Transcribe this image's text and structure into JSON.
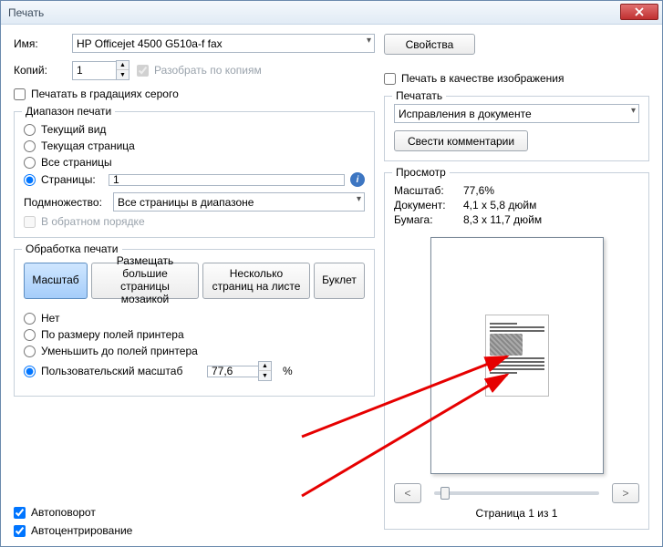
{
  "window": {
    "title": "Печать"
  },
  "top": {
    "name_label": "Имя:",
    "printer": "HP Officejet 4500 G510a-f fax",
    "properties_btn": "Свойства",
    "copies_label": "Копий:",
    "copies_value": "1",
    "collate_label": "Разобрать по копиям",
    "grayscale_label": "Печатать в градациях серого",
    "as_image_label": "Печать в качестве изображения"
  },
  "range": {
    "legend": "Диапазон печати",
    "current_view": "Текущий вид",
    "current_page": "Текущая страница",
    "all_pages": "Все страницы",
    "pages": "Страницы:",
    "pages_value": "1",
    "subset_label": "Подмножество:",
    "subset_value": "Все страницы в диапазоне",
    "reverse_label": "В обратном порядке"
  },
  "handling": {
    "legend": "Обработка печати",
    "tabs": {
      "scale": "Масштаб",
      "tile": "Размещать большие страницы мозаикой",
      "multiple": "Несколько страниц на листе",
      "booklet": "Буклет"
    },
    "fit_none": "Нет",
    "fit_margins": "По размеру полей принтера",
    "shrink_margins": "Уменьшить до полей принтера",
    "custom_scale": "Пользовательский масштаб",
    "custom_value": "77,6",
    "percent": "%"
  },
  "footer": {
    "auto_rotate": "Автоповорот",
    "auto_center": "Автоцентрирование"
  },
  "print_section": {
    "legend": "Печатать",
    "what": "Исправления в документе",
    "summarize_btn": "Свести комментарии"
  },
  "preview": {
    "legend": "Просмотр",
    "scale_label": "Масштаб:",
    "scale_value": "77,6%",
    "doc_label": "Документ:",
    "doc_value": "4,1 x 5,8 дюйм",
    "paper_label": "Бумага:",
    "paper_value": "8,3 x 11,7 дюйм",
    "page_status": "Страница 1 из 1"
  }
}
